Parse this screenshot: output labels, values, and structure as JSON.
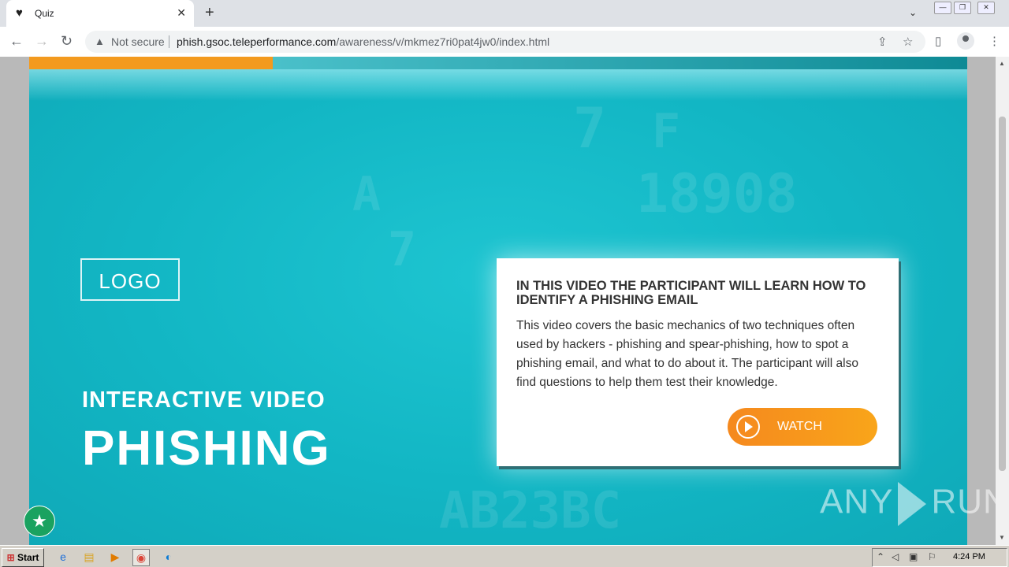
{
  "browser": {
    "tab_title": "Quiz",
    "tab_close": "✕",
    "new_tab": "+",
    "security_label": "Not secure",
    "url_host": "phish.gsoc.teleperformance.com",
    "url_path": "/awareness/v/mkmez7ri0pat4jw0/index.html"
  },
  "page": {
    "progress_percent": 26,
    "logo_text": "LOGO",
    "subtitle": "INTERACTIVE VIDEO",
    "title": "PHISHING",
    "card": {
      "heading": "IN THIS VIDEO THE PARTICIPANT WILL LEARN HOW TO IDENTIFY A PHISHING EMAIL",
      "body": "This video covers the basic mechanics of two techniques often used by hackers - phishing and spear-phishing, how to spot a phishing email, and what to do about it. The participant will also find questions to help them test their knowledge.",
      "watch_label": "WATCH"
    },
    "background_digits": [
      "7",
      "F",
      "18908",
      "A",
      "7",
      "AB23BC"
    ],
    "watermark_left": "ANY",
    "watermark_right": "RUN"
  },
  "taskbar": {
    "start_label": "Start",
    "clock": "4:24 PM"
  },
  "colors": {
    "accent_orange": "#f39a1e",
    "stage_teal": "#12b6c4",
    "fab_green": "#1aa260"
  }
}
